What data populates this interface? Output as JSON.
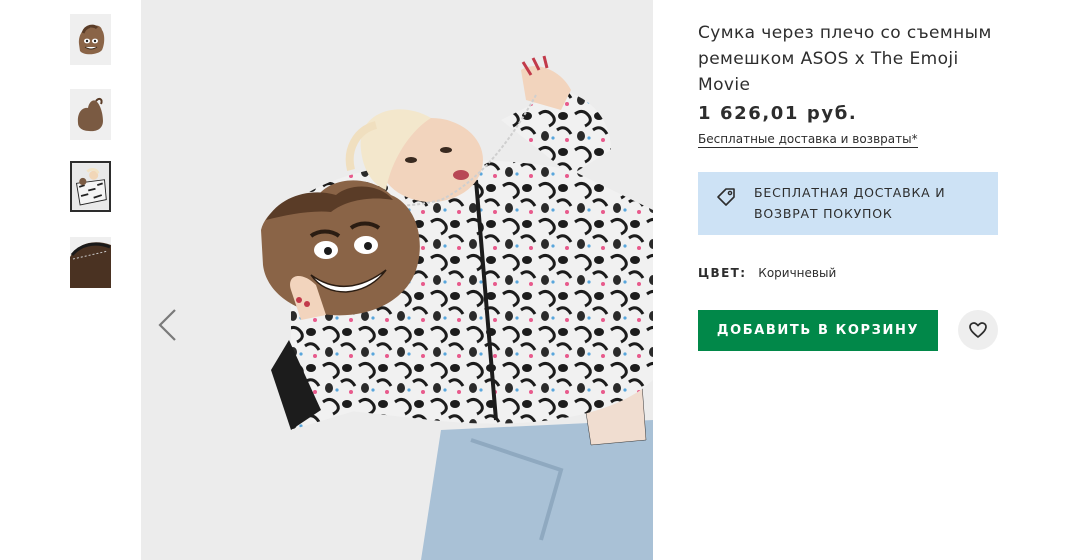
{
  "product": {
    "title": "Сумка через плечо со съемным ремешком ASOS x The Emoji Movie",
    "price": "1 626,01 руб.",
    "delivery_link": "Бесплатные доставка и возвраты",
    "delivery_link_marker": "*",
    "color_label": "ЦВЕТ:",
    "color_value": "Коричневый",
    "add_to_cart_label": "ДОБАВИТЬ В КОРЗИНУ"
  },
  "banner": {
    "text": "БЕСПЛАТНАЯ ДОСТАВКА И ВОЗВРАТ ПОКУПОК",
    "icon": "price-tag-icon",
    "background": "#cde2f5"
  },
  "gallery": {
    "active_thumbnail": 3,
    "thumbnails": [
      {
        "description_icon": "bag-front-thumbnail"
      },
      {
        "description_icon": "bag-back-thumbnail"
      },
      {
        "description_icon": "model-thumbnail"
      },
      {
        "description_icon": "bag-detail-thumbnail"
      }
    ],
    "prev_icon": "chevron-left-icon"
  },
  "colors": {
    "accent_green": "#018849",
    "text": "#2d2d2d",
    "save_button_bg": "#eeeeee"
  },
  "icons": {
    "save": "heart-icon"
  }
}
